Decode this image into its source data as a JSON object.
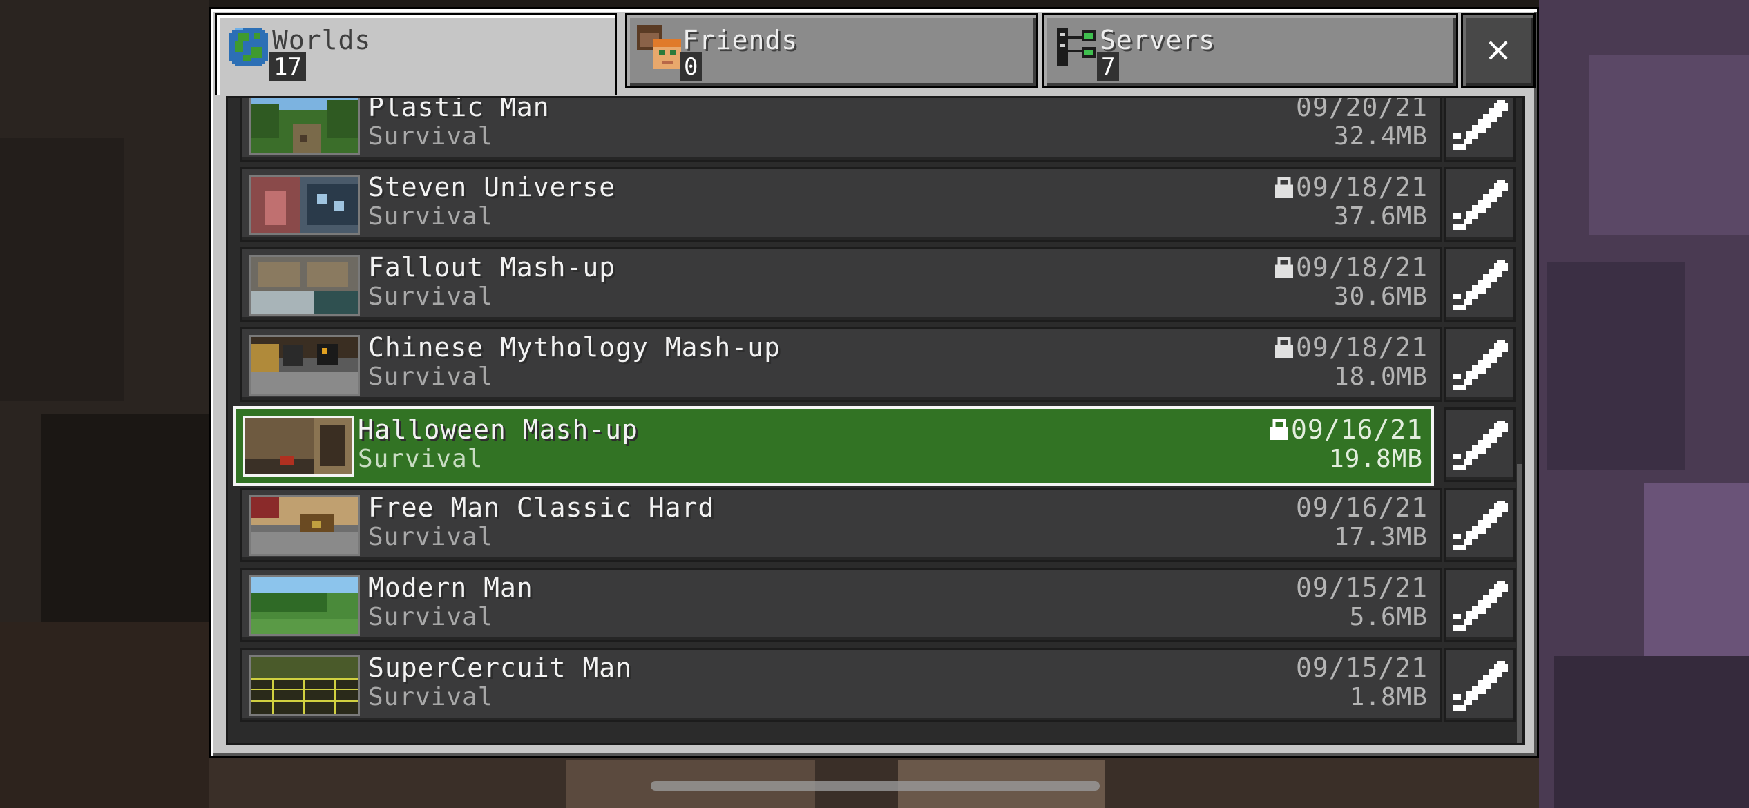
{
  "tabs": [
    {
      "label": "Worlds",
      "count": "17",
      "icon": "globe-icon",
      "active": true
    },
    {
      "label": "Friends",
      "count": "0",
      "icon": "friends-icon",
      "active": false
    },
    {
      "label": "Servers",
      "count": "7",
      "icon": "servers-icon",
      "active": false
    }
  ],
  "close_label": "×",
  "worlds": [
    {
      "name": "Plastic Man",
      "mode": "Survival",
      "date": "09/20/21",
      "size": "32.4MB",
      "locked": false,
      "selected": false
    },
    {
      "name": "Steven Universe",
      "mode": "Survival",
      "date": "09/18/21",
      "size": "37.6MB",
      "locked": true,
      "selected": false
    },
    {
      "name": "Fallout Mash-up",
      "mode": "Survival",
      "date": "09/18/21",
      "size": "30.6MB",
      "locked": true,
      "selected": false
    },
    {
      "name": "Chinese Mythology Mash-up",
      "mode": "Survival",
      "date": "09/18/21",
      "size": "18.0MB",
      "locked": true,
      "selected": false
    },
    {
      "name": "Halloween Mash-up",
      "mode": "Survival",
      "date": "09/16/21",
      "size": "19.8MB",
      "locked": true,
      "selected": true
    },
    {
      "name": "Free Man Classic Hard",
      "mode": "Survival",
      "date": "09/16/21",
      "size": "17.3MB",
      "locked": false,
      "selected": false
    },
    {
      "name": "Modern Man",
      "mode": "Survival",
      "date": "09/15/21",
      "size": "5.6MB",
      "locked": false,
      "selected": false
    },
    {
      "name": "SuperCercuit Man",
      "mode": "Survival",
      "date": "09/15/21",
      "size": "1.8MB",
      "locked": false,
      "selected": false
    }
  ],
  "colors": {
    "selected_row": "#327324",
    "row": "#3a3a3b",
    "panel": "#c6c6c6"
  }
}
